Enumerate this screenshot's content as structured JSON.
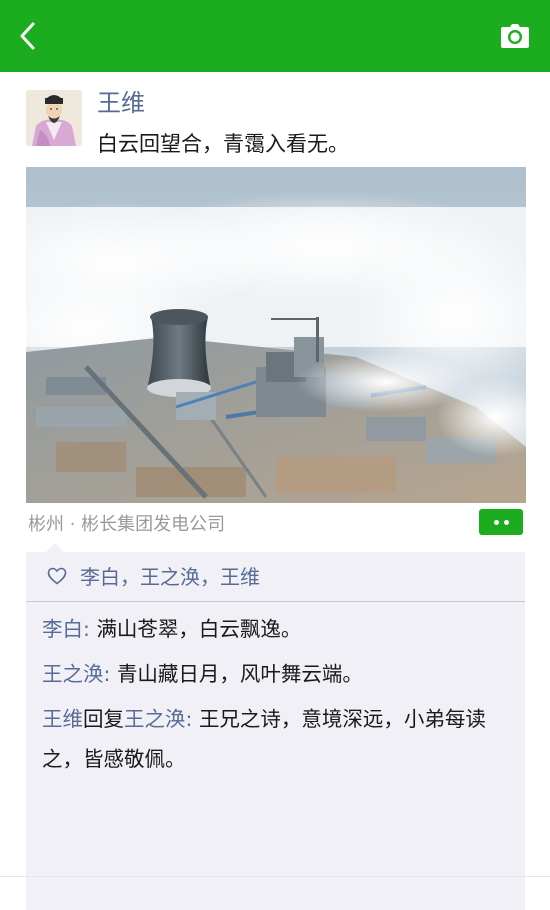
{
  "header": {
    "back_icon": "chevron-left-icon",
    "camera_icon": "camera-icon",
    "bg_color": "#1bad1f"
  },
  "post": {
    "author": "王维",
    "text": "白云回望合，青霭入看无。",
    "location": "彬州 · 彬长集团发电公司"
  },
  "likes": {
    "icon": "heart-outline-icon",
    "names": "李白，王之涣，王维"
  },
  "comments": [
    {
      "name": "李白",
      "sep": ": ",
      "text": "满山苍翠，白云飘逸。"
    },
    {
      "name": "王之涣",
      "sep": ": ",
      "text": "青山藏日月，风叶舞云端。"
    },
    {
      "name": "王维",
      "reply_word": "回复",
      "reply_to": "王之涣",
      "sep": ": ",
      "text": "王兄之诗，意境深远，小弟每读之，皆感敬佩。"
    }
  ],
  "colors": {
    "brand_green": "#1bad1f",
    "name_blue": "#576b95",
    "comment_bg": "#f0f0f6"
  }
}
